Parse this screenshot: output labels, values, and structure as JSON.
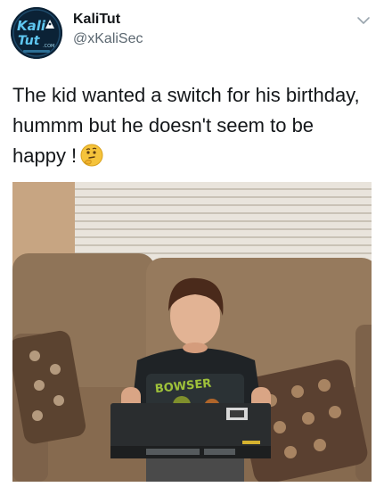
{
  "header": {
    "display_name": "KaliTut",
    "handle": "@xKaliSec",
    "avatar_logo_text": "KaliTut.COM",
    "menu_icon": "chevron-down-icon"
  },
  "tweet": {
    "text": "The kid wanted a switch for his birthday, hummm but he doesn't seem to be happy  !",
    "emoji": "thinking-face-icon"
  },
  "photo": {
    "shirt_print": "BOWSER"
  },
  "colors": {
    "text": "#14171a",
    "secondary": "#5b6770",
    "avatar_bg": "#0b2236",
    "avatar_accent": "#5fc7f0"
  }
}
